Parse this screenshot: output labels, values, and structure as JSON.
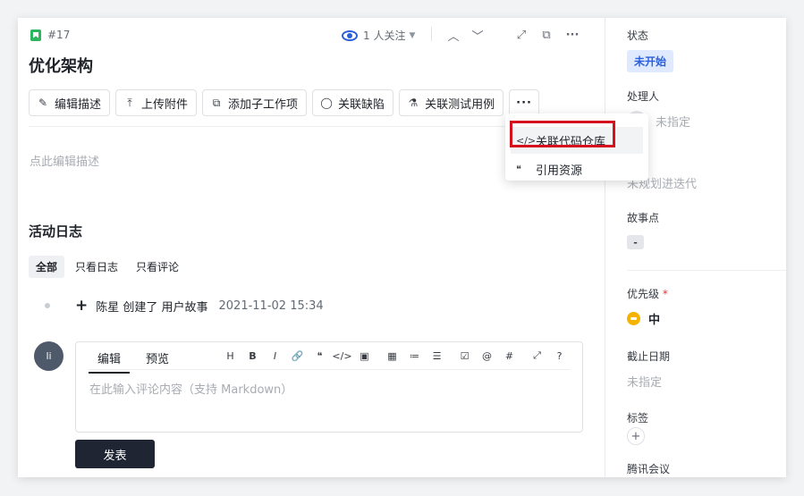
{
  "header": {
    "issue_id": "#17",
    "watch_text": "1 人关注",
    "title": "优化架构"
  },
  "toolbar": {
    "buttons": [
      {
        "label": "编辑描述",
        "icon": "pencil-icon"
      },
      {
        "label": "上传附件",
        "icon": "upload-icon"
      },
      {
        "label": "添加子工作项",
        "icon": "subtask-icon"
      },
      {
        "label": "关联缺陷",
        "icon": "bug-icon"
      },
      {
        "label": "关联测试用例",
        "icon": "flask-icon"
      }
    ],
    "more_label": "···"
  },
  "dropdown": {
    "items": [
      {
        "label": "关联代码仓库",
        "icon": "code-icon"
      },
      {
        "label": "引用资源",
        "icon": "quote-icon"
      }
    ]
  },
  "description_placeholder": "点此编辑描述",
  "activity": {
    "title": "活动日志",
    "tabs": [
      "全部",
      "只看日志",
      "只看评论"
    ],
    "entries": [
      {
        "text": "陈星 创建了 用户故事",
        "time": "2021-11-02 15:34"
      }
    ]
  },
  "comment": {
    "avatar_initials": "li",
    "tabs": [
      "编辑",
      "预览"
    ],
    "toolbar": [
      "H",
      "B",
      "I",
      "🔗",
      "❝",
      "</>",
      "▣",
      "▦",
      "≔",
      "☰",
      "☑",
      "@",
      "#",
      "⤢",
      "?"
    ],
    "placeholder": "在此输入评论内容（支持 Markdown）",
    "submit_label": "发表"
  },
  "sidebar": {
    "status_label": "状态",
    "status_value": "未开始",
    "assignee_label": "处理人",
    "assignee_value": "未指定",
    "iteration_value": "未规划进迭代",
    "storypoint_label": "故事点",
    "storypoint_value": "-",
    "priority_label": "优先级",
    "priority_required": "*",
    "priority_value": "中",
    "deadline_label": "截止日期",
    "deadline_value": "未指定",
    "tags_label": "标签",
    "tags_add": "+",
    "meeting_label": "腾讯会议"
  },
  "colors": {
    "accent": "#2b5fd9",
    "highlight_box": "#d4111c",
    "priority_medium": "#f3b300",
    "submit_bg": "#1f2533"
  }
}
